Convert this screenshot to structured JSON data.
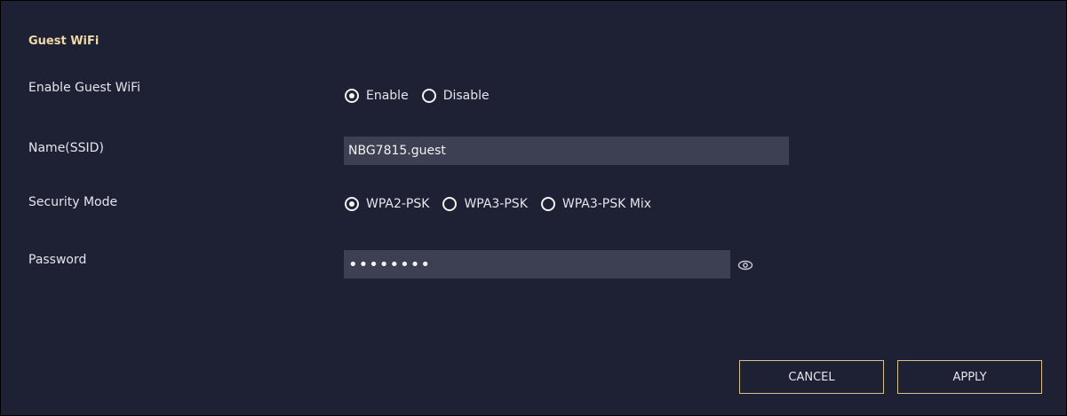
{
  "section": {
    "title": "Guest WiFi"
  },
  "enable": {
    "label": "Enable Guest WiFi",
    "options": [
      {
        "label": "Enable",
        "selected": true
      },
      {
        "label": "Disable",
        "selected": false
      }
    ]
  },
  "ssid": {
    "label": "Name(SSID)",
    "value": "NBG7815.guest"
  },
  "security": {
    "label": "Security Mode",
    "options": [
      {
        "label": "WPA2-PSK",
        "selected": true
      },
      {
        "label": "WPA3-PSK",
        "selected": false
      },
      {
        "label": "WPA3-PSK Mix",
        "selected": false
      }
    ]
  },
  "password": {
    "label": "Password",
    "value": "••••••••",
    "toggle_icon": "eye-icon"
  },
  "buttons": {
    "cancel": "CANCEL",
    "apply": "APPLY"
  },
  "colors": {
    "background": "#1e2034",
    "field": "#3d3f53",
    "accent": "#d9c08b",
    "title": "#f0d9a6"
  }
}
